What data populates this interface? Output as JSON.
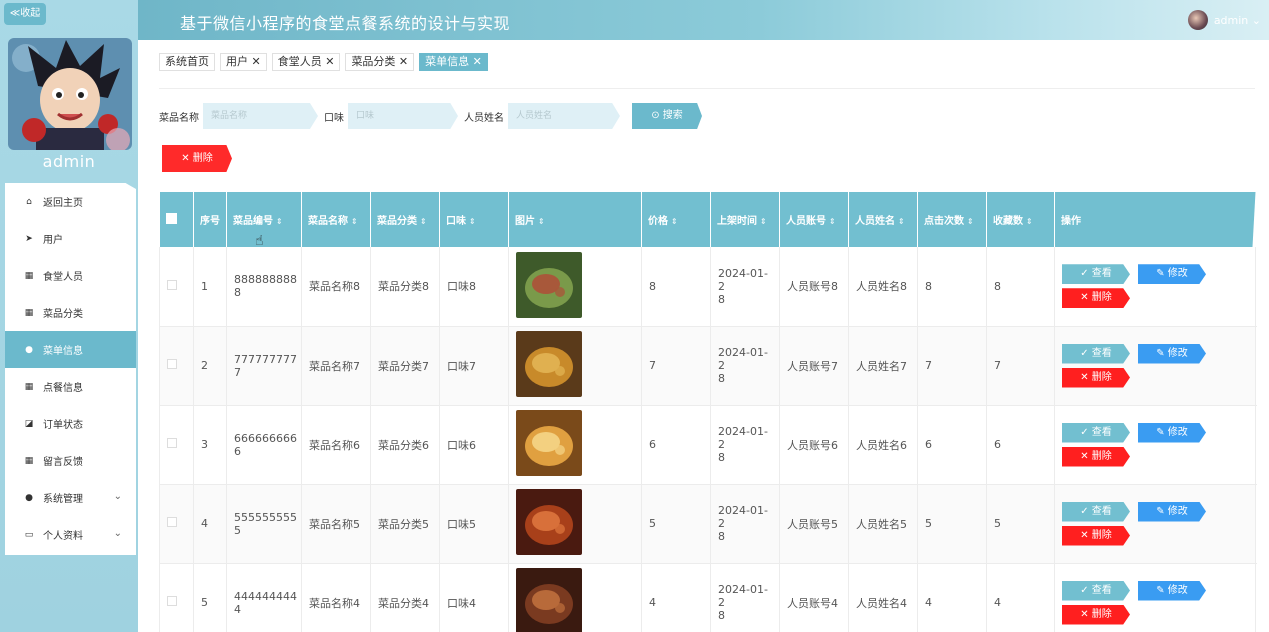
{
  "sidebar": {
    "collapse_label": "≪收起",
    "username": "admin",
    "items": [
      {
        "label": "返回主页",
        "icon": "⌂",
        "active": false
      },
      {
        "label": "用户",
        "icon": "➤",
        "active": false
      },
      {
        "label": "食堂人员",
        "icon": "▦",
        "active": false
      },
      {
        "label": "菜品分类",
        "icon": "▦",
        "active": false
      },
      {
        "label": "菜单信息",
        "icon": "●",
        "active": true
      },
      {
        "label": "点餐信息",
        "icon": "▦",
        "active": false
      },
      {
        "label": "订单状态",
        "icon": "◪",
        "active": false
      },
      {
        "label": "留言反馈",
        "icon": "▦",
        "active": false
      },
      {
        "label": "系统管理",
        "icon": "●",
        "active": false,
        "chevron": "⌄"
      },
      {
        "label": "个人资料",
        "icon": "▭",
        "active": false,
        "chevron": "⌄"
      }
    ]
  },
  "header": {
    "title": "基于微信小程序的食堂点餐系统的设计与实现",
    "user": "admin ⌄"
  },
  "tabs": [
    "系统首页",
    "用户 ✕",
    "食堂人员 ✕",
    "菜品分类 ✕",
    "菜单信息 ✕"
  ],
  "search": {
    "f1_label": "菜品名称",
    "f1_placeholder": "菜品名称",
    "f2_label": "口味",
    "f2_placeholder": "口味",
    "f3_label": "人员姓名",
    "f3_placeholder": "人员姓名",
    "button": "⊙ 搜索"
  },
  "delete_button": "✕ 删除",
  "table": {
    "headers": [
      "序号",
      "菜品编号",
      "菜品名称",
      "菜品分类",
      "口味",
      "图片",
      "价格",
      "上架时间",
      "人员账号",
      "人员姓名",
      "点击次数",
      "收藏数",
      "操作"
    ],
    "sort_mark": "⇕",
    "buttons": {
      "view": "✓ 查看",
      "edit": "✎ 修改",
      "del": "✕ 删除"
    },
    "rows": [
      {
        "idx": "1",
        "code": "888888888\n8",
        "name": "菜品名称8",
        "cat": "菜品分类8",
        "taste": "口味8",
        "price": "8",
        "time": "2024-01-2\n8",
        "acct": "人员账号8",
        "person": "人员姓名8",
        "clicks": "8",
        "favs": "8",
        "img": [
          "#3e5a2a",
          "#7a9a4a",
          "#a8583a"
        ]
      },
      {
        "idx": "2",
        "code": "777777777\n7",
        "name": "菜品名称7",
        "cat": "菜品分类7",
        "taste": "口味7",
        "price": "7",
        "time": "2024-01-2\n8",
        "acct": "人员账号7",
        "person": "人员姓名7",
        "clicks": "7",
        "favs": "7",
        "img": [
          "#5a3a1a",
          "#c88a2a",
          "#e0b050"
        ]
      },
      {
        "idx": "3",
        "code": "666666666\n6",
        "name": "菜品名称6",
        "cat": "菜品分类6",
        "taste": "口味6",
        "price": "6",
        "time": "2024-01-2\n8",
        "acct": "人员账号6",
        "person": "人员姓名6",
        "clicks": "6",
        "favs": "6",
        "img": [
          "#7a4a1a",
          "#e0a040",
          "#f3d080"
        ]
      },
      {
        "idx": "4",
        "code": "555555555\n5",
        "name": "菜品名称5",
        "cat": "菜品分类5",
        "taste": "口味5",
        "price": "5",
        "time": "2024-01-2\n8",
        "acct": "人员账号5",
        "person": "人员姓名5",
        "clicks": "5",
        "favs": "5",
        "img": [
          "#4a1a10",
          "#a8401a",
          "#d8703a"
        ]
      },
      {
        "idx": "5",
        "code": "444444444\n4",
        "name": "菜品名称4",
        "cat": "菜品分类4",
        "taste": "口味4",
        "price": "4",
        "time": "2024-01-2\n8",
        "acct": "人员账号4",
        "person": "人员姓名4",
        "clicks": "4",
        "favs": "4",
        "img": [
          "#3a1a10",
          "#7a3a20",
          "#b86a3a"
        ]
      }
    ]
  },
  "colors": {
    "accent": "#6bb9cc",
    "danger": "#ff1f1f",
    "edit": "#3a9cf2"
  }
}
